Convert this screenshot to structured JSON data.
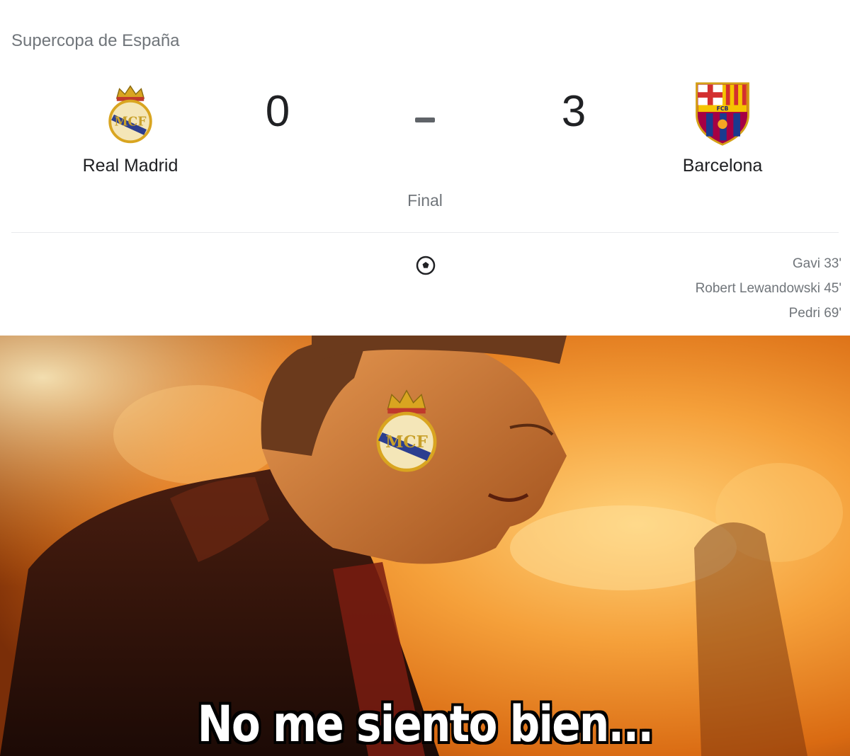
{
  "match": {
    "competition": "Supercopa de España",
    "home_team": {
      "name": "Real Madrid",
      "score": "0",
      "crest_icon": "real-madrid-crest-icon"
    },
    "away_team": {
      "name": "Barcelona",
      "score": "3",
      "crest_icon": "fc-barcelona-crest-icon"
    },
    "separator": "-",
    "status": "Final",
    "goal_icon": "soccer-ball-icon",
    "scorers": [
      {
        "label": "Gavi 33'"
      },
      {
        "label": "Robert Lewandowski 45'"
      },
      {
        "label": "Pedri 69'"
      }
    ]
  },
  "meme": {
    "caption": "No me siento bien...",
    "image": "fiery-orange-scene-person-with-real-madrid-crest-on-face",
    "colors": {
      "fire": "#f28a1a",
      "glow": "#ffd27a",
      "dark": "#3a1407"
    }
  }
}
